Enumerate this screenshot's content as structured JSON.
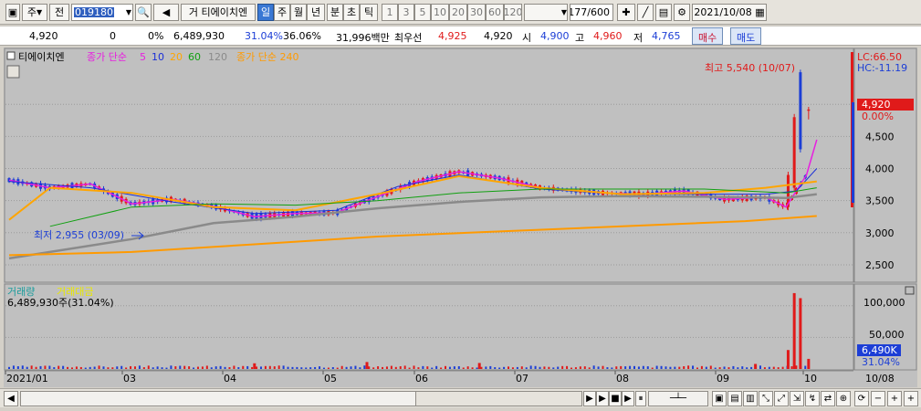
{
  "toolbar": {
    "type_label": "주",
    "type_arrow": "▼",
    "prev_label": "전",
    "code": "019180",
    "dd_arrow": "▼",
    "search_label": "🔍",
    "sound_label": "◀",
    "trade_label": "거",
    "stock_name": "티에이치엔",
    "periods": [
      "일",
      "주",
      "월",
      "년",
      "분",
      "초",
      "틱"
    ],
    "active_period": "일",
    "minutes": [
      "1",
      "3",
      "5",
      "10",
      "20",
      "30",
      "60",
      "120"
    ],
    "count_label": "177/600",
    "date": "2021/10/08"
  },
  "info": {
    "price": "4,920",
    "change": "0",
    "change_pct": "0%",
    "volume": "6,489,930",
    "volume_pct": "31.04%",
    "turnover": "36.06%",
    "amount": "31,996백만",
    "pref_label": "최우선",
    "ask": "4,925",
    "bid": "4,920",
    "open_label": "시",
    "open": "4,900",
    "high_label": "고",
    "high": "4,960",
    "low_label": "저",
    "low": "4,765",
    "buy_label": "매수",
    "sell_label": "매도"
  },
  "price_panel": {
    "legend": {
      "name": "티에이치엔",
      "ma_label": "종가 단순",
      "ma_periods": [
        "5",
        "10",
        "20",
        "60",
        "120"
      ],
      "long_label": "종가 단순 240"
    },
    "max_label": "최고 5,540 (10/07)",
    "min_label": "최저 2,955 (03/09)",
    "right_badge": "LC:66.50",
    "right_badge2": "HC:-11.19",
    "price_tag": "4,920",
    "pct_tag": "0.00%",
    "y_ticks": [
      "5,000",
      "4,500",
      "4,000",
      "3,500",
      "3,000",
      "2,500"
    ]
  },
  "volume_panel": {
    "legend1": "거래량",
    "legend2": "거래대금",
    "value_text": "6,489,930주(31.04%)",
    "y_ticks": [
      "100,000",
      "50,000"
    ],
    "vol_tag": "6,490K",
    "vol_pct": "31.04%"
  },
  "x_axis": {
    "labels": [
      "2021/01",
      "03",
      "04",
      "05",
      "06",
      "07",
      "08",
      "09",
      "10"
    ],
    "end_label": "10/08"
  },
  "colors": {
    "up": "#e01a1a",
    "down": "#1c3ed6",
    "ma5": "#e81ee0",
    "ma10": "#1a2fd8",
    "ma20": "#ffa500",
    "ma60": "#10a010",
    "ma120": "#8a8a8a",
    "ma240": "#ff9a00",
    "panel_bg": "#c0c0c0"
  },
  "chart_data": {
    "type": "candlestick",
    "y_range": [
      2300,
      5800
    ],
    "x_months": [
      "2021/01",
      "03",
      "04",
      "05",
      "06",
      "07",
      "08",
      "09",
      "10"
    ],
    "high": {
      "value": 5540,
      "date": "10/07"
    },
    "low": {
      "value": 2955,
      "date": "03/09"
    },
    "last": {
      "close": 4920,
      "open": 4900,
      "high": 4960,
      "low": 4765,
      "date": "10/08"
    },
    "series": [
      {
        "name": "5",
        "approx_points": [
          [
            0,
            3820
          ],
          [
            20,
            3700
          ],
          [
            40,
            3760
          ],
          [
            60,
            3450
          ],
          [
            80,
            3520
          ],
          [
            100,
            3410
          ],
          [
            120,
            3250
          ],
          [
            140,
            3300
          ],
          [
            160,
            3310
          ],
          [
            175,
            3500
          ],
          [
            200,
            3800
          ],
          [
            220,
            3950
          ],
          [
            240,
            3850
          ],
          [
            260,
            3700
          ],
          [
            290,
            3620
          ],
          [
            310,
            3600
          ],
          [
            330,
            3650
          ],
          [
            350,
            3520
          ],
          [
            370,
            3550
          ],
          [
            380,
            3400
          ],
          [
            390,
            3900
          ],
          [
            395,
            4450
          ]
        ]
      },
      {
        "name": "10",
        "approx_points": [
          [
            0,
            3800
          ],
          [
            40,
            3700
          ],
          [
            80,
            3480
          ],
          [
            120,
            3300
          ],
          [
            160,
            3350
          ],
          [
            190,
            3720
          ],
          [
            220,
            3900
          ],
          [
            260,
            3680
          ],
          [
            300,
            3600
          ],
          [
            340,
            3600
          ],
          [
            370,
            3600
          ],
          [
            385,
            3650
          ],
          [
            395,
            4000
          ]
        ]
      },
      {
        "name": "20",
        "approx_points": [
          [
            0,
            3200
          ],
          [
            20,
            3700
          ],
          [
            60,
            3620
          ],
          [
            100,
            3400
          ],
          [
            140,
            3350
          ],
          [
            180,
            3600
          ],
          [
            220,
            3880
          ],
          [
            260,
            3700
          ],
          [
            300,
            3600
          ],
          [
            340,
            3620
          ],
          [
            370,
            3700
          ],
          [
            395,
            3800
          ]
        ]
      },
      {
        "name": "60",
        "approx_points": [
          [
            20,
            3100
          ],
          [
            60,
            3400
          ],
          [
            100,
            3450
          ],
          [
            140,
            3430
          ],
          [
            180,
            3500
          ],
          [
            220,
            3620
          ],
          [
            260,
            3680
          ],
          [
            300,
            3680
          ],
          [
            340,
            3680
          ],
          [
            380,
            3620
          ],
          [
            395,
            3700
          ]
        ]
      },
      {
        "name": "120",
        "approx_points": [
          [
            0,
            2600
          ],
          [
            60,
            2900
          ],
          [
            100,
            3150
          ],
          [
            140,
            3250
          ],
          [
            180,
            3380
          ],
          [
            220,
            3480
          ],
          [
            260,
            3550
          ],
          [
            300,
            3570
          ],
          [
            340,
            3560
          ],
          [
            380,
            3540
          ],
          [
            395,
            3600
          ]
        ]
      },
      {
        "name": "240",
        "approx_points": [
          [
            0,
            2650
          ],
          [
            60,
            2700
          ],
          [
            120,
            2820
          ],
          [
            180,
            2940
          ],
          [
            240,
            3020
          ],
          [
            300,
            3100
          ],
          [
            360,
            3180
          ],
          [
            395,
            3260
          ]
        ]
      }
    ],
    "volume_y_range": [
      0,
      130000
    ],
    "volume_notes": "small bars; large spike at 10/07"
  },
  "scrollbar": {
    "play": "▶",
    "next": "▶|",
    "stop": "■",
    "pause": "▮▮",
    "minus": "−",
    "plus": "+"
  }
}
